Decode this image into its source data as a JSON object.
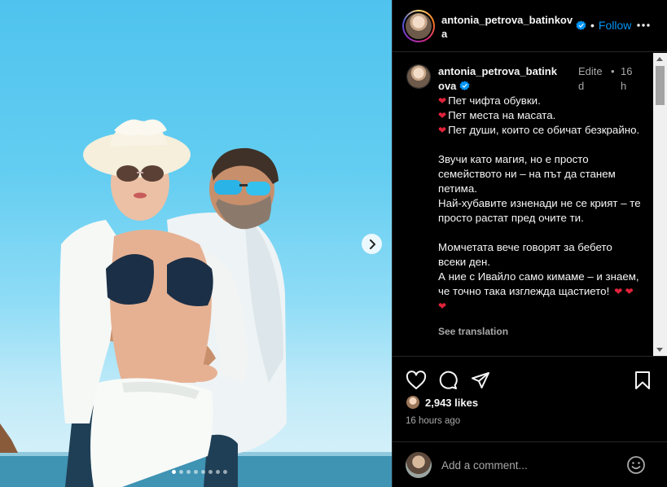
{
  "post": {
    "username": "antonia_petrova_batinkova",
    "follow_label": "Follow",
    "separator": "•",
    "edited_label": "Edited",
    "time_short": "16h",
    "caption_lines": [
      {
        "heart": "❤",
        "text": "Пет чифта обувки."
      },
      {
        "heart": "❤",
        "text": "Пет места на масата."
      },
      {
        "heart": "❤",
        "text": "Пет души, които се обичат безкрайно."
      },
      {
        "heart": "",
        "text": ""
      },
      {
        "heart": "",
        "text": "Звучи като магия, но е просто семейството ни – на път да станем петима."
      },
      {
        "heart": "",
        "text": "Най-хубавите изненади не се крият – те просто растат пред очите ти."
      },
      {
        "heart": "",
        "text": ""
      },
      {
        "heart": "",
        "text": "Момчетата вече говорят за бебето всеки ден."
      },
      {
        "heart": "",
        "text": "А ние с Ивайло само кимаме – и знаем, че точно така изглежда щастието!"
      }
    ],
    "caption_end_hearts": "❤ ❤ ❤",
    "see_translation": "See translation",
    "likes": "2,943 likes",
    "time_ago": "16 hours ago",
    "comment_placeholder": "Add a comment...",
    "carousel": {
      "total": 8,
      "active": 0
    }
  },
  "icons": {
    "verified": "verified-badge-icon",
    "more": "more-options-icon",
    "like": "heart-icon",
    "comment": "comment-bubble-icon",
    "share": "paper-plane-icon",
    "save": "bookmark-icon",
    "emoji": "emoji-smile-icon",
    "next": "chevron-right-icon"
  },
  "colors": {
    "follow": "#0095f6",
    "verified": "#0095f6",
    "heart_emoji": "#e0233b",
    "background": "#000000",
    "secondary_text": "#a8a8a8"
  }
}
